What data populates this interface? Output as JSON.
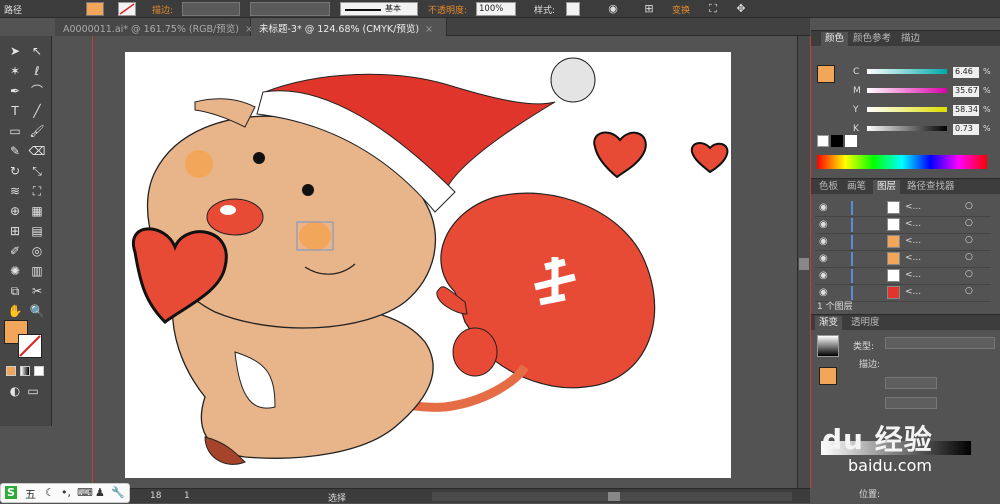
{
  "control_bar": {
    "path_label": "路径",
    "stroke_label": "描边:",
    "stroke_style": "基本",
    "opacity_label": "不透明度:",
    "opacity_value": "100%",
    "style_label": "样式:",
    "transform_label": "变换",
    "fill_color": "#f2a65a"
  },
  "doc_tabs": [
    {
      "label": "A0000011.ai* @ 161.75% (RGB/预览)",
      "close": "×"
    },
    {
      "label": "未标题-3* @ 124.68% (CMYK/预览)",
      "close": "×"
    }
  ],
  "status_bar": {
    "zoom": "18",
    "artboard": "1",
    "tool": "选择"
  },
  "color_panel": {
    "tabs": [
      "颜色",
      "颜色参考",
      "描边"
    ],
    "channels": [
      {
        "name": "C",
        "value": "6.46",
        "pct": "%"
      },
      {
        "name": "M",
        "value": "35.67",
        "pct": "%"
      },
      {
        "name": "Y",
        "value": "58.34",
        "pct": "%"
      },
      {
        "name": "K",
        "value": "0.73",
        "pct": "%"
      }
    ]
  },
  "layers_panel": {
    "tabs": [
      "色板",
      "画笔",
      "图层",
      "路径查找器"
    ],
    "rows": [
      {
        "name": "<..."
      },
      {
        "name": "<..."
      },
      {
        "name": "<..."
      },
      {
        "name": "<..."
      },
      {
        "name": "<..."
      },
      {
        "name": "<..."
      }
    ],
    "footer": "1 个图层"
  },
  "gradient_panel": {
    "tabs": [
      "渐变",
      "透明度"
    ],
    "type_label": "类型:",
    "stroke_label": "描边:",
    "position_label": "位置:"
  },
  "watermark": {
    "line1": "du 经验",
    "line2": "baidu.com"
  },
  "ime": {
    "label": "五"
  },
  "colors": {
    "fill": "#f2a65a",
    "red": "#e0352b",
    "skin": "#e8b48a"
  }
}
